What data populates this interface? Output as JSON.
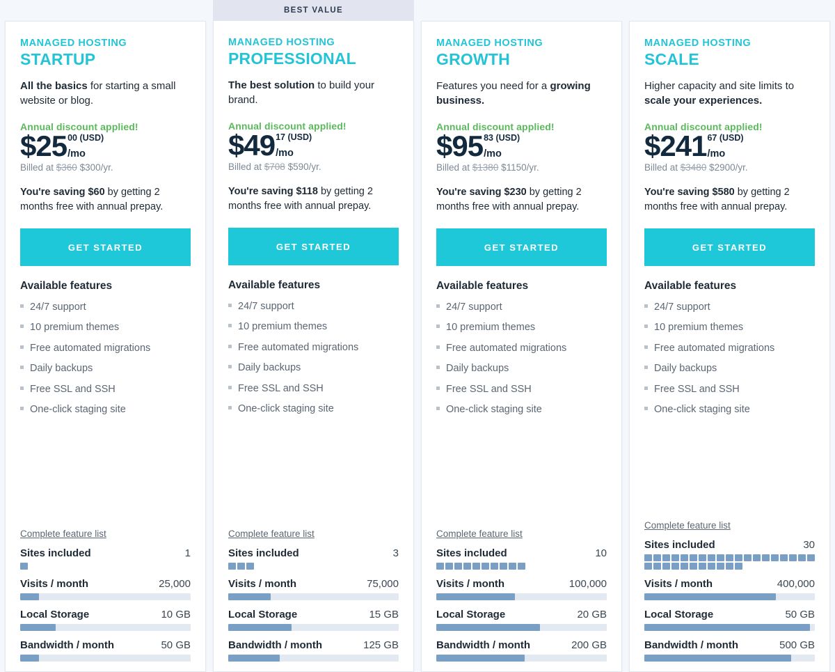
{
  "page": {
    "background": "#f4f7fb",
    "accent_teal": "#23c4d6",
    "cta_color": "#1ec8d8",
    "discount_green": "#5cb85c",
    "bar_color": "#7a9fc4",
    "bar_track": "#e3e9f0"
  },
  "banner": {
    "label": "BEST VALUE"
  },
  "labels": {
    "eyebrow": "MANAGED HOSTING",
    "currency": "(USD)",
    "per_month": "/mo",
    "cta": "GET STARTED",
    "features_title": "Available features",
    "complete_feature_list": "Complete feature list",
    "metric_sites": "Sites included",
    "metric_visits": "Visits / month",
    "metric_storage": "Local Storage",
    "metric_bandwidth": "Bandwidth / month"
  },
  "features": [
    "24/7 support",
    "10 premium themes",
    "Free automated migrations",
    "Daily backups",
    "Free SSL and SSH",
    "One-click staging site"
  ],
  "plans": [
    {
      "name": "STARTUP",
      "best_value": false,
      "tagline_bold": "All the basics",
      "tagline_rest": " for starting a small website or blog.",
      "discount_note": "Annual discount applied!",
      "price_whole": "$25",
      "price_cents": "00",
      "billed_old": "$360",
      "billed_new": "$300/yr.",
      "billed_prefix": "Billed at ",
      "savings_bold": "You're saving $60",
      "savings_rest": " by getting 2 months free with annual prepay.",
      "sites": {
        "value": "1",
        "blocks": 1
      },
      "visits": {
        "value": "25,000",
        "percent": 11
      },
      "storage": {
        "value": "10 GB",
        "percent": 21
      },
      "bandwidth": {
        "value": "50 GB",
        "percent": 11
      }
    },
    {
      "name": "PROFESSIONAL",
      "best_value": true,
      "tagline_bold": "The best solution",
      "tagline_rest": " to build your brand.",
      "discount_note": "Annual discount applied!",
      "price_whole": "$49",
      "price_cents": "17",
      "billed_old": "$708",
      "billed_new": "$590/yr.",
      "billed_prefix": "Billed at ",
      "savings_bold": "You're saving $118",
      "savings_rest": " by getting 2 months free with annual prepay.",
      "sites": {
        "value": "3",
        "blocks": 3
      },
      "visits": {
        "value": "75,000",
        "percent": 25
      },
      "storage": {
        "value": "15 GB",
        "percent": 37
      },
      "bandwidth": {
        "value": "125 GB",
        "percent": 30
      }
    },
    {
      "name": "GROWTH",
      "best_value": false,
      "tagline_bold_last": "growing business.",
      "tagline_lead": "Features you need for a ",
      "discount_note": "Annual discount applied!",
      "price_whole": "$95",
      "price_cents": "83",
      "billed_old": "$1380",
      "billed_new": "$1150/yr.",
      "billed_prefix": "Billed at ",
      "savings_bold": "You're saving $230",
      "savings_rest": " by getting 2 months free with annual prepay.",
      "sites": {
        "value": "10",
        "blocks": 10
      },
      "visits": {
        "value": "100,000",
        "percent": 46
      },
      "storage": {
        "value": "20 GB",
        "percent": 61
      },
      "bandwidth": {
        "value": "200 GB",
        "percent": 52
      }
    },
    {
      "name": "SCALE",
      "best_value": false,
      "tagline_bold_last": "scale your experiences.",
      "tagline_lead": "Higher capacity and site limits to ",
      "discount_note": "Annual discount applied!",
      "price_whole": "$241",
      "price_cents": "67",
      "billed_old": "$3480",
      "billed_new": "$2900/yr.",
      "billed_prefix": "Billed at ",
      "savings_bold": "You're saving $580",
      "savings_rest": " by getting 2 months free with annual prepay.",
      "sites": {
        "value": "30",
        "blocks": 30
      },
      "visits": {
        "value": "400,000",
        "percent": 77
      },
      "storage": {
        "value": "50 GB",
        "percent": 97
      },
      "bandwidth": {
        "value": "500 GB",
        "percent": 86
      }
    }
  ]
}
